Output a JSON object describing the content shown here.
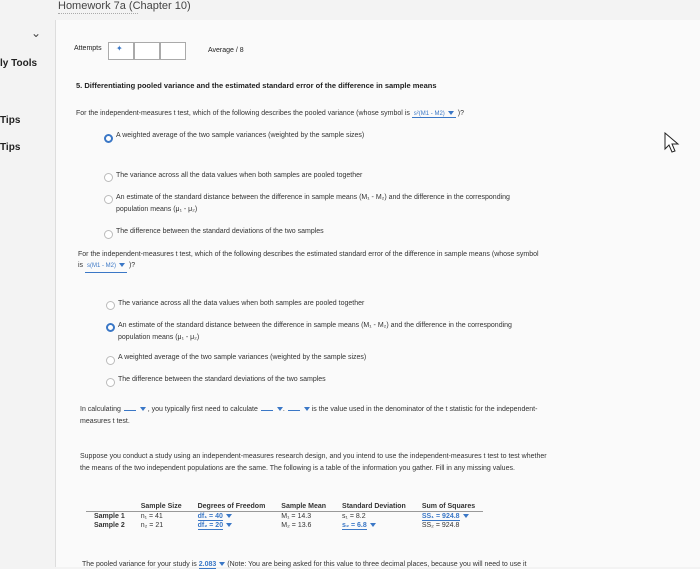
{
  "header": {
    "title": "Homework 7a (Chapter 10)"
  },
  "sidebar": {
    "items": [
      "ly Tools",
      "Tips",
      "Tips"
    ]
  },
  "attempts": {
    "label": "Attempts",
    "average": "Average / 8"
  },
  "section": {
    "title": "5. Differentiating pooled variance and the estimated standard error of the difference in sample means"
  },
  "q1": {
    "prompt_pre": "For the independent-measures t test, which of the following describes the pooled variance (whose symbol is",
    "symbol": "s²(M1 - M2)",
    "prompt_post": ")?",
    "options": [
      "A weighted average of the two sample variances (weighted by the sample sizes)",
      "The variance across all the data values when both samples are pooled together",
      "An estimate of the standard distance between the difference in sample means (M₁ - M₂) and the difference in the corresponding",
      "The difference between the standard deviations of the two samples"
    ],
    "option3_cont": "population means (μ₁ - μ₂)",
    "selected_index": 0
  },
  "q2": {
    "prompt": "For the independent-measures t test, which of the following describes the estimated standard error of the difference in sample means (whose symbol",
    "prompt_is": "is",
    "symbol": "s(M1 - M2)",
    "prompt_post": ")?",
    "options": [
      "The variance across all the data values when both samples are pooled together",
      "An estimate of the standard distance between the difference in sample means (M₁ - M₂) and the difference in the corresponding",
      "A weighted average of the two sample variances (weighted by the sample sizes)",
      "The difference between the standard deviations of the two samples"
    ],
    "option2_cont": "population means (μ₁ - μ₂)",
    "selected_index": 1
  },
  "fill": {
    "part1": "In calculating",
    "part2": ", you typically first need to calculate",
    "part3": ".",
    "part4": "is the value used in the denominator of the t statistic for the independent-",
    "line2": "measures t test."
  },
  "scenario": {
    "line1": "Suppose you conduct a study using an independent-measures research design, and you intend to use the independent-measures t test to test whether",
    "line2": "the means of the two independent populations are the same. The following is a table of the information you gather. Fill in any missing values."
  },
  "table": {
    "headers": [
      "",
      "Sample Size",
      "Degrees of Freedom",
      "Sample Mean",
      "Standard Deviation",
      "Sum of Squares"
    ],
    "rows": [
      {
        "label": "Sample 1",
        "n": "n₁ = 41",
        "df": "df₁ = 40",
        "mean": "M₁ = 14.3",
        "sd": "s₁ = 8.2",
        "ss": "SS₁ = 924.8"
      },
      {
        "label": "Sample 2",
        "n": "n₂ = 21",
        "df": "df₂ = 20",
        "mean": "M₂ = 13.6",
        "sd": "s₂ = 6.8",
        "ss": "SS₂ = 924.8"
      }
    ]
  },
  "pooled": {
    "pre": "The pooled variance for your study is",
    "value": "2.083",
    "note": "(Note: You are being asked for this value to three decimal places, because you will need to use it"
  },
  "colors": {
    "accent": "#3a77c6"
  }
}
